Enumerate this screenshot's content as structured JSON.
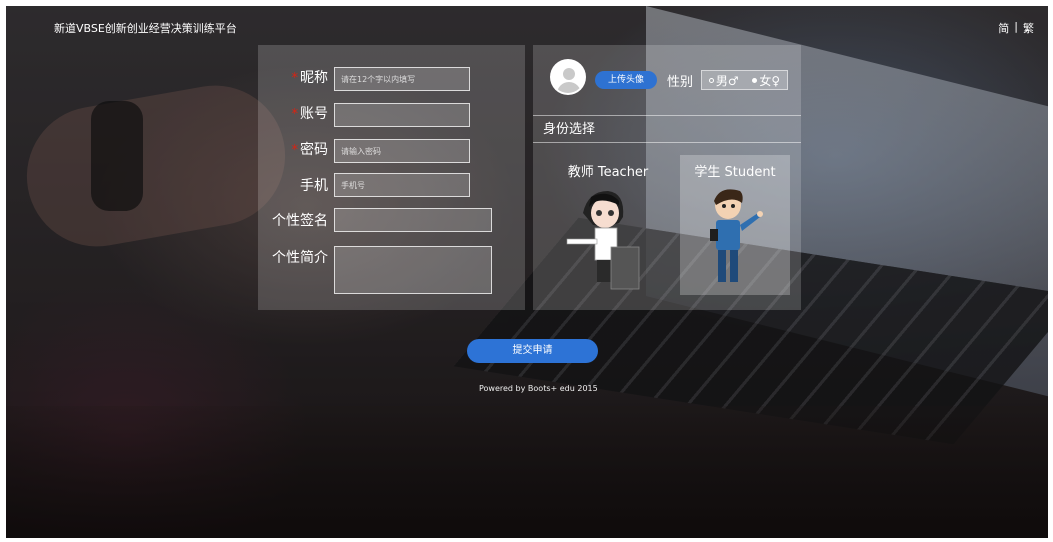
{
  "brand": "新道VBSE创新创业经营决策训练平台",
  "lang": {
    "simplified": "简",
    "separator": "|",
    "traditional": "繁"
  },
  "form": {
    "nickname": {
      "label": "昵称",
      "placeholder": "请在12个字以内填写"
    },
    "account": {
      "label": "账号",
      "placeholder": ""
    },
    "password": {
      "label": "密码",
      "placeholder": "请输入密码"
    },
    "phone": {
      "label": "手机",
      "placeholder": "手机号"
    },
    "signature": {
      "label": "个性签名",
      "placeholder": ""
    },
    "intro": {
      "label": "个性简介",
      "placeholder": ""
    },
    "required_mark": "*"
  },
  "profile": {
    "upload_label": "上传头像",
    "gender_label": "性别",
    "gender_options": [
      {
        "label": "男♂",
        "selected": false
      },
      {
        "label": "女♀",
        "selected": true
      }
    ]
  },
  "identity": {
    "title": "身份选择",
    "roles": [
      {
        "label": "教师 Teacher",
        "selected": false
      },
      {
        "label": "学生 Student",
        "selected": true
      }
    ]
  },
  "submit_label": "提交申请",
  "footer": "Powered by Boots+ edu 2015",
  "colors": {
    "accent": "#2e72d2",
    "required": "#dd2211"
  }
}
